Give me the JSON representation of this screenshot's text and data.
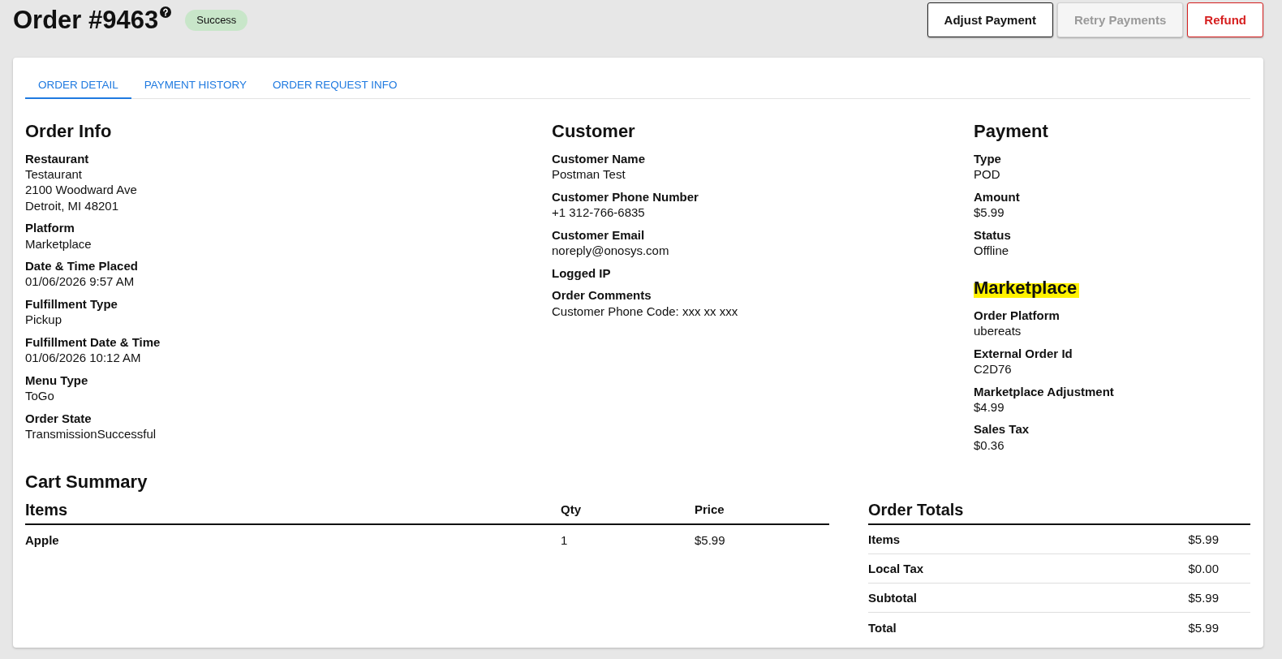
{
  "header": {
    "title": "Order #9463",
    "status": {
      "label": "Success",
      "kind": "success"
    },
    "buttons": [
      {
        "label": "Adjust Payment",
        "kind": "default",
        "disabled": false
      },
      {
        "label": "Retry Payments",
        "kind": "default",
        "disabled": true
      },
      {
        "label": "Refund",
        "kind": "danger",
        "disabled": false
      }
    ]
  },
  "tabs": [
    {
      "label": "ORDER DETAIL",
      "selected": true
    },
    {
      "label": "PAYMENT HISTORY",
      "selected": false
    },
    {
      "label": "ORDER REQUEST INFO",
      "selected": false
    }
  ],
  "columns": [
    {
      "sections": [
        {
          "title": "Order Info",
          "highlighted": false,
          "fields": [
            {
              "label": "Restaurant",
              "lines": [
                "Testaurant",
                "2100 Woodward Ave",
                "Detroit, MI 48201"
              ]
            },
            {
              "label": "Platform",
              "lines": [
                "Marketplace"
              ]
            },
            {
              "label": "Date & Time Placed",
              "lines": [
                "01/06/2026 9:57 AM"
              ]
            },
            {
              "label": "Fulfillment Type",
              "lines": [
                "Pickup"
              ]
            },
            {
              "label": "Fulfillment Date & Time",
              "lines": [
                "01/06/2026 10:12 AM"
              ]
            },
            {
              "label": "Menu Type",
              "lines": [
                "ToGo"
              ]
            },
            {
              "label": "Order State",
              "lines": [
                "TransmissionSuccessful"
              ]
            }
          ]
        }
      ]
    },
    {
      "sections": [
        {
          "title": "Customer",
          "highlighted": false,
          "fields": [
            {
              "label": "Customer Name",
              "lines": [
                "Postman Test"
              ]
            },
            {
              "label": "Customer Phone Number",
              "lines": [
                "+1 312-766-6835"
              ]
            },
            {
              "label": "Customer Email",
              "lines": [
                "noreply@onosys.com"
              ]
            },
            {
              "label": "Logged IP"
            },
            {
              "label": "Order Comments",
              "lines": [
                "Customer Phone Code: xxx xx xxx"
              ]
            }
          ]
        }
      ]
    },
    {
      "sections": [
        {
          "title": "Payment",
          "highlighted": false,
          "fields": [
            {
              "label": "Type",
              "lines": [
                "POD"
              ]
            },
            {
              "label": "Amount",
              "lines": [
                "$5.99"
              ]
            },
            {
              "label": "Status",
              "lines": [
                "Offline"
              ]
            }
          ]
        },
        {
          "title": "Marketplace",
          "highlighted": true,
          "fields": [
            {
              "label": "Order Platform",
              "lines": [
                "ubereats"
              ]
            },
            {
              "label": "External Order Id",
              "lines": [
                "C2D76"
              ]
            },
            {
              "label": "Marketplace Adjustment",
              "lines": [
                "$4.99"
              ]
            },
            {
              "label": "Sales Tax",
              "lines": [
                "$0.36"
              ]
            }
          ]
        }
      ]
    }
  ],
  "cart_summary": {
    "title": "Cart Summary",
    "columns": [
      "Items",
      "Qty",
      "Price"
    ],
    "rows": [
      [
        "Apple",
        "1",
        "$5.99"
      ]
    ]
  },
  "order_totals": {
    "title": "Order Totals",
    "rows": [
      {
        "label": "Items",
        "value": "$5.99"
      },
      {
        "label": "Local Tax",
        "value": "$0.00"
      },
      {
        "label": "Subtotal",
        "value": "$5.99"
      },
      {
        "label": "Total",
        "value": "$5.99"
      }
    ]
  }
}
